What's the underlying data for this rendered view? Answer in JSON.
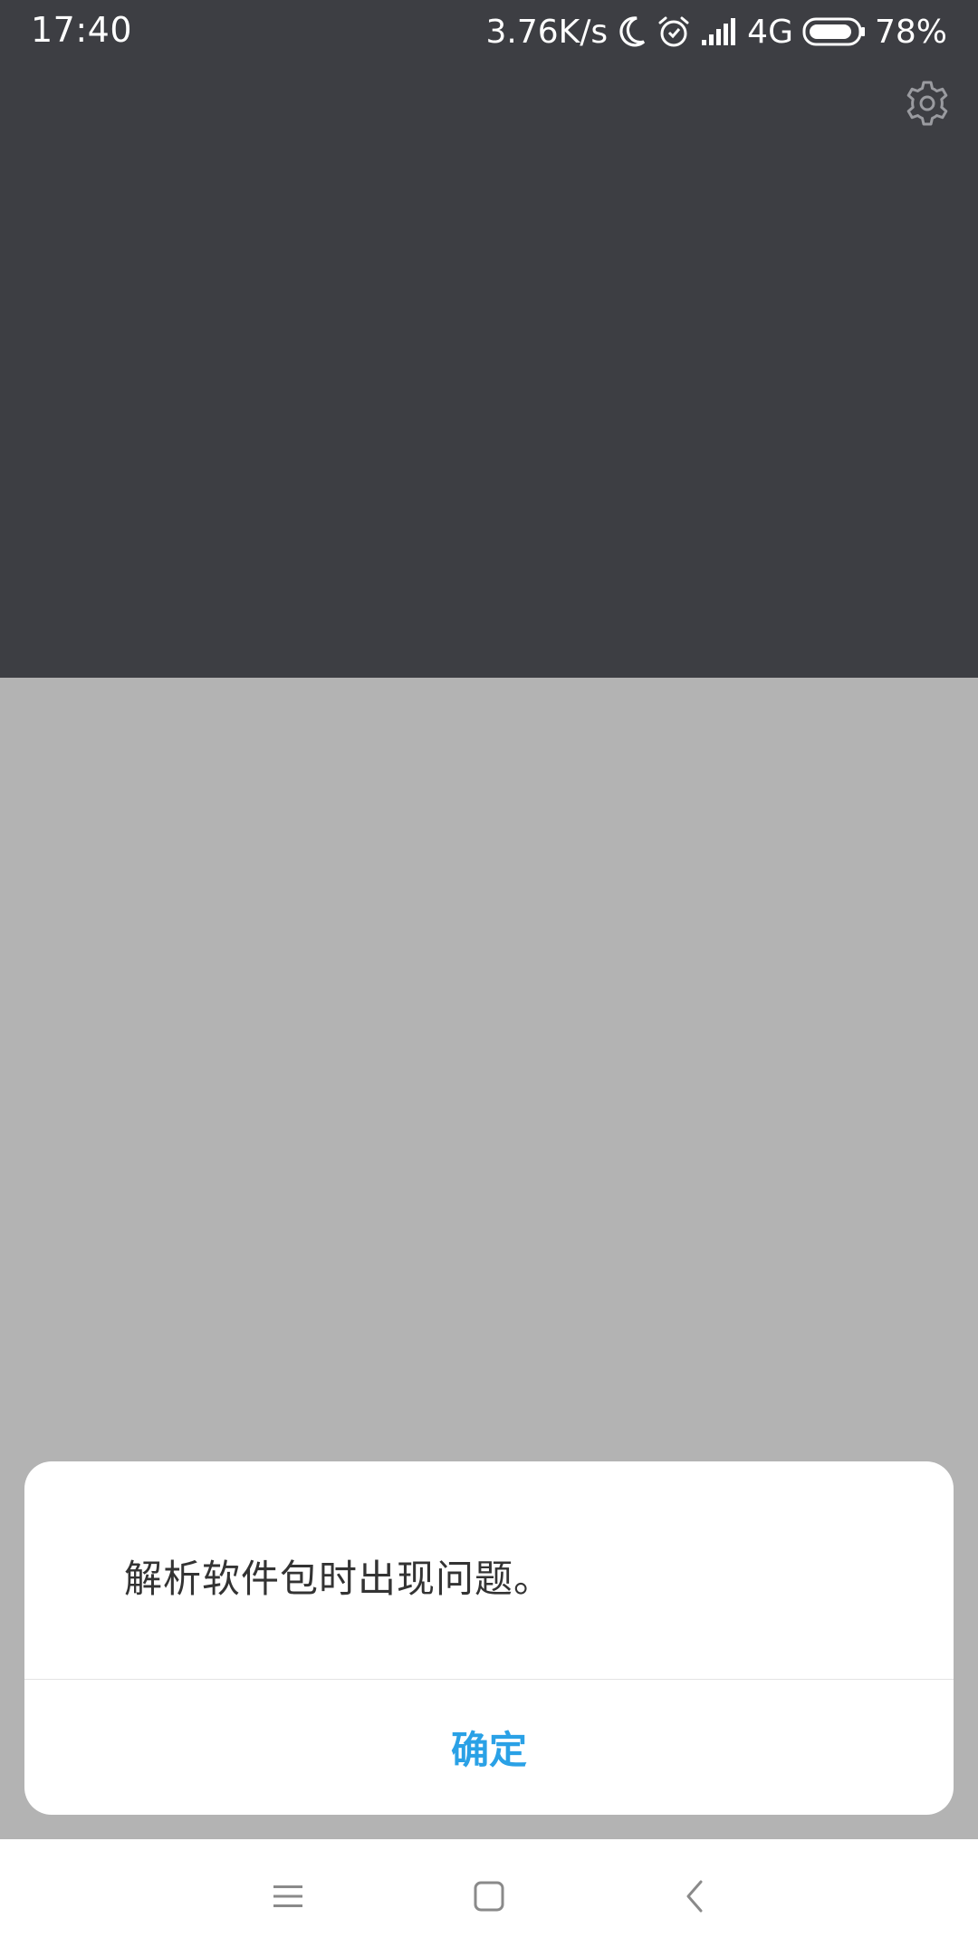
{
  "status_bar": {
    "time": "17:40",
    "network_speed": "3.76K/s",
    "network_type": "4G",
    "battery": "78%",
    "icons": [
      "moon-icon",
      "alarm-icon",
      "signal-icon",
      "battery-icon"
    ]
  },
  "app": {
    "settings_icon": "gear-icon"
  },
  "dialog": {
    "message": "解析软件包时出现问题。",
    "ok_label": "确定",
    "accent_color": "#2aa1e6"
  },
  "nav_bar": {
    "icons": [
      "menu-icon",
      "home-icon",
      "back-icon"
    ]
  },
  "colors": {
    "top_background": "#3d3e43",
    "scrim": "#b3b3b3"
  }
}
